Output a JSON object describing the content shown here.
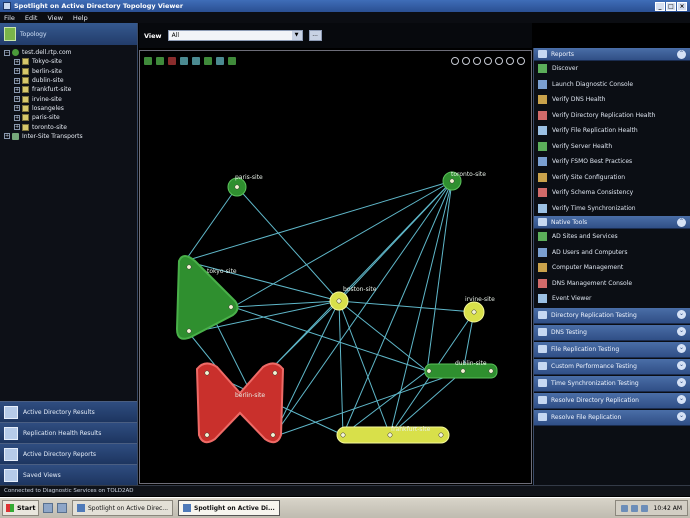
{
  "window": {
    "title": "Spotlight on Active Directory Topology Viewer",
    "controls": [
      "_",
      "□",
      "×"
    ]
  },
  "menu": {
    "items": [
      "File",
      "Edit",
      "View",
      "Help"
    ]
  },
  "left_pane": {
    "header_label": "Topology",
    "tree": [
      {
        "label": "test.dell.rtp.com",
        "icon": "domain-icon",
        "level": 0
      },
      {
        "label": "Tokyo-site",
        "icon": "site-icon",
        "level": 1
      },
      {
        "label": "berlin-site",
        "icon": "site-icon",
        "level": 1
      },
      {
        "label": "dublin-site",
        "icon": "site-icon",
        "level": 1
      },
      {
        "label": "frankfurt-site",
        "icon": "site-icon",
        "level": 1
      },
      {
        "label": "irvine-site",
        "icon": "site-icon",
        "level": 1
      },
      {
        "label": "losangeles",
        "icon": "site-icon",
        "level": 1
      },
      {
        "label": "paris-site",
        "icon": "site-icon",
        "level": 1
      },
      {
        "label": "toronto-site",
        "icon": "site-icon",
        "level": 1
      },
      {
        "label": "Inter-Site Transports",
        "icon": "transports-icon",
        "level": 0
      }
    ],
    "nav_buttons": [
      {
        "label": "Active Directory Results",
        "icon": "results-icon"
      },
      {
        "label": "Replication Health Results",
        "icon": "replication-icon"
      },
      {
        "label": "Active Directory Reports",
        "icon": "reports-icon"
      },
      {
        "label": "Saved Views",
        "icon": "views-icon"
      }
    ]
  },
  "view_bar": {
    "label": "View",
    "value": "All",
    "more_label": "..."
  },
  "graph": {
    "nodes": [
      {
        "id": "paris",
        "label": "paris-site",
        "color": "green"
      },
      {
        "id": "toronto",
        "label": "toronto-site",
        "color": "green"
      },
      {
        "id": "tokyo",
        "label": "tokyo-site",
        "color": "green"
      },
      {
        "id": "boston",
        "label": "boston-site",
        "color": "yellow"
      },
      {
        "id": "irvine",
        "label": "irvine-site",
        "color": "yellow"
      },
      {
        "id": "dublin",
        "label": "dublin-site",
        "color": "green"
      },
      {
        "id": "berlin",
        "label": "berlin-site",
        "color": "red"
      },
      {
        "id": "frankfurt",
        "label": "frankfurt-site",
        "color": "yellow"
      }
    ],
    "colors": {
      "link": "#5fb7c9",
      "green": "#2f8f2f",
      "yellow": "#d8e04a",
      "red": "#c9302c",
      "label": "#e8f0e8"
    }
  },
  "right_pane": {
    "sections": [
      {
        "title": "Reports",
        "icon": "reports-icon",
        "expanded": true,
        "items": [
          "Discover",
          "Launch Diagnostic Console",
          "Verify DNS Health",
          "Verify Directory Replication Health",
          "Verify File Replication Health",
          "Verify Server Health",
          "Verify FSMO Best Practices",
          "Verify Site Configuration",
          "Verify Schema Consistency",
          "Verify Time Synchronization"
        ]
      },
      {
        "title": "Native Tools",
        "icon": "tools-icon",
        "expanded": true,
        "items": [
          "AD Sites and Services",
          "AD Users and Computers",
          "Computer Management",
          "DNS Management Console",
          "Event Viewer"
        ]
      },
      {
        "title": "Directory Replication Testing",
        "expanded": false
      },
      {
        "title": "DNS Testing",
        "expanded": false
      },
      {
        "title": "File Replication Testing",
        "expanded": false
      },
      {
        "title": "Custom Performance Testing",
        "expanded": false
      },
      {
        "title": "Time Synchronization Testing",
        "expanded": false
      },
      {
        "title": "Resolve Directory Replication",
        "expanded": false
      },
      {
        "title": "Resolve File Replication",
        "expanded": false
      }
    ]
  },
  "status_bar": {
    "text": "Connected to Diagnostic Services on TOLD2AD"
  },
  "taskbar": {
    "start_label": "Start",
    "tasks": [
      {
        "label": "Spotlight on Active Direc...",
        "active": false
      },
      {
        "label": "Spotlight on Active Di...",
        "active": true
      }
    ],
    "clock": "10:42 AM"
  }
}
